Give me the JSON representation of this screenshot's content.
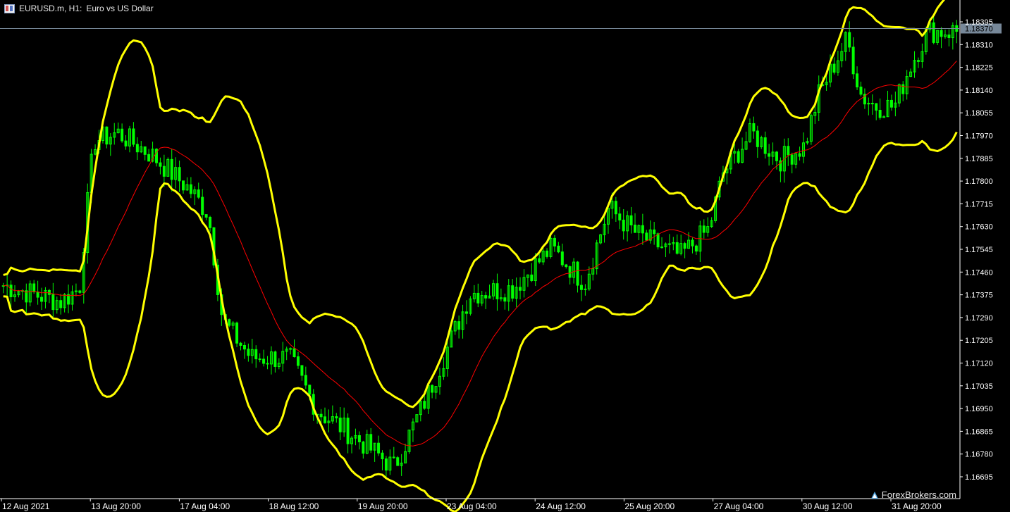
{
  "header": {
    "symbol_timeframe": "EURUSD.m, H1:",
    "description": "Euro vs US Dollar",
    "icon": "chart-window-icon"
  },
  "watermark": {
    "text": "ForexBrokers.com",
    "icon": "forexbrokers-logo-icon"
  },
  "colors": {
    "background": "#000000",
    "candle": "#00ff00",
    "bollinger": "#ffff00",
    "middle_line": "#ff0000",
    "price_line": "#778899",
    "text": "#ffffff",
    "bid_label_bg": "#778899"
  },
  "chart_data": {
    "type": "candlestick",
    "symbol": "EURUSD.m",
    "timeframe": "H1",
    "indicators": [
      "Bollinger Bands"
    ],
    "grid": false,
    "ylim": [
      1.1665,
      1.1845
    ],
    "y_ticks": [
      "1.18395",
      "1.18310",
      "1.18225",
      "1.18140",
      "1.18055",
      "1.17970",
      "1.17885",
      "1.17800",
      "1.17715",
      "1.17630",
      "1.17545",
      "1.17460",
      "1.17375",
      "1.17290",
      "1.17205",
      "1.17120",
      "1.17035",
      "1.16950",
      "1.16865",
      "1.16780",
      "1.16695"
    ],
    "current_price": "1.18370",
    "x_ticks": [
      "12 Aug 2021",
      "13 Aug 20:00",
      "17 Aug 04:00",
      "18 Aug 12:00",
      "19 Aug 20:00",
      "23 Aug 04:00",
      "24 Aug 12:00",
      "25 Aug 20:00",
      "27 Aug 04:00",
      "30 Aug 12:00",
      "31 Aug 20:00"
    ],
    "anchors": [
      {
        "t": 0,
        "p": 1.1741
      },
      {
        "t": 0.06,
        "p": 1.1735
      },
      {
        "t": 0.08,
        "p": 1.174
      },
      {
        "t": 0.085,
        "p": 1.176
      },
      {
        "t": 0.095,
        "p": 1.1795
      },
      {
        "t": 0.12,
        "p": 1.1798
      },
      {
        "t": 0.155,
        "p": 1.179
      },
      {
        "t": 0.195,
        "p": 1.1777
      },
      {
        "t": 0.215,
        "p": 1.1768
      },
      {
        "t": 0.23,
        "p": 1.1728
      },
      {
        "t": 0.26,
        "p": 1.1714
      },
      {
        "t": 0.3,
        "p": 1.1714
      },
      {
        "t": 0.33,
        "p": 1.1694
      },
      {
        "t": 0.355,
        "p": 1.1688
      },
      {
        "t": 0.385,
        "p": 1.168
      },
      {
        "t": 0.41,
        "p": 1.1673
      },
      {
        "t": 0.445,
        "p": 1.17
      },
      {
        "t": 0.49,
        "p": 1.1738
      },
      {
        "t": 0.535,
        "p": 1.174
      },
      {
        "t": 0.575,
        "p": 1.1755
      },
      {
        "t": 0.61,
        "p": 1.1742
      },
      {
        "t": 0.635,
        "p": 1.177
      },
      {
        "t": 0.665,
        "p": 1.176
      },
      {
        "t": 0.71,
        "p": 1.1752
      },
      {
        "t": 0.74,
        "p": 1.1762
      },
      {
        "t": 0.755,
        "p": 1.1783
      },
      {
        "t": 0.785,
        "p": 1.1798
      },
      {
        "t": 0.815,
        "p": 1.1788
      },
      {
        "t": 0.84,
        "p": 1.1793
      },
      {
        "t": 0.855,
        "p": 1.1812
      },
      {
        "t": 0.875,
        "p": 1.1826
      },
      {
        "t": 0.885,
        "p": 1.1833
      },
      {
        "t": 0.9,
        "p": 1.1812
      },
      {
        "t": 0.915,
        "p": 1.1808
      },
      {
        "t": 0.935,
        "p": 1.1808
      },
      {
        "t": 0.95,
        "p": 1.1822
      },
      {
        "t": 0.97,
        "p": 1.1836
      }
    ]
  }
}
